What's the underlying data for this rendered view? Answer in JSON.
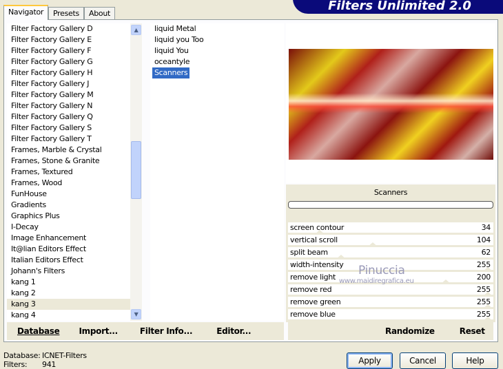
{
  "app": {
    "title": "Filters Unlimited 2.0"
  },
  "tabs": [
    {
      "label": "Navigator",
      "active": true
    },
    {
      "label": "Presets"
    },
    {
      "label": "About"
    }
  ],
  "categories": [
    "Filter Factory Gallery D",
    "Filter Factory Gallery E",
    "Filter Factory Gallery F",
    "Filter Factory Gallery G",
    "Filter Factory Gallery H",
    "Filter Factory Gallery J",
    "Filter Factory Gallery M",
    "Filter Factory Gallery N",
    "Filter Factory Gallery Q",
    "Filter Factory Gallery S",
    "Filter Factory Gallery T",
    "Frames, Marble & Crystal",
    "Frames, Stone & Granite",
    "Frames, Textured",
    "Frames, Wood",
    "FunHouse",
    "Gradients",
    "Graphics Plus",
    "I-Decay",
    "Image Enhancement",
    "It@lian Editors Effect",
    "Italian Editors Effect",
    "Johann's Filters",
    "kang 1",
    "kang 2",
    "kang 3",
    "kang 4"
  ],
  "selected_category": "kang 3",
  "filters": [
    "liquid Metal",
    "liquid you Too",
    "liquid You",
    "oceantyle",
    "Scanners"
  ],
  "selected_filter": "Scanners",
  "preview": {
    "filter_name": "Scanners",
    "progress": 0
  },
  "params": [
    {
      "label": "screen contour",
      "value": 34
    },
    {
      "label": "vertical scroll",
      "value": 104
    },
    {
      "label": "split beam",
      "value": 62
    },
    {
      "label": "width-intensity",
      "value": 255
    },
    {
      "label": "remove light",
      "value": 200
    },
    {
      "label": "remove red",
      "value": 255
    },
    {
      "label": "remove green",
      "value": 255
    },
    {
      "label": "remove blue",
      "value": 255
    }
  ],
  "watermark": {
    "name": "Pinuccia",
    "url": "www.maidiregrafica.eu"
  },
  "left_buttons": {
    "database": "Database",
    "import": "Import...",
    "filter_info": "Filter Info...",
    "editor": "Editor..."
  },
  "right_buttons": {
    "randomize": "Randomize",
    "reset": "Reset"
  },
  "status": {
    "database_label": "Database:",
    "database_value": "ICNET-Filters",
    "filters_label": "Filters:",
    "filters_value": "941"
  },
  "dialog_buttons": {
    "apply": "Apply",
    "cancel": "Cancel",
    "help": "Help"
  }
}
